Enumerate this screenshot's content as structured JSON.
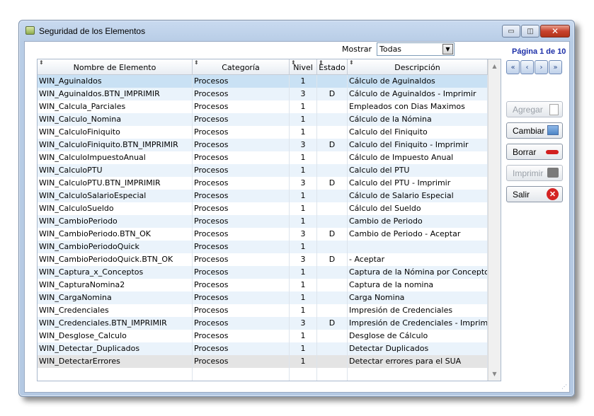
{
  "window": {
    "title": "Seguridad de los Elementos"
  },
  "filter": {
    "label": "Mostrar",
    "value": "Todas"
  },
  "pagination": {
    "text": "Página 1 de 10"
  },
  "actions": {
    "agregar": "Agregar",
    "cambiar": "Cambiar",
    "borrar": "Borrar",
    "imprimir": "Imprimir",
    "salir": "Salir"
  },
  "grid": {
    "headers": [
      "Nombre de Elemento",
      "Categoría",
      "Nivel",
      "Estado",
      "Descripción"
    ],
    "rows": [
      [
        "WIN_Aguinaldos",
        "Procesos",
        "1",
        "",
        "Cálculo de Aguinaldos"
      ],
      [
        "WIN_Aguinaldos.BTN_IMPRIMIR",
        "Procesos",
        "3",
        "D",
        "Cálculo de Aguinaldos - Imprimir"
      ],
      [
        "WIN_Calcula_Parciales",
        "Procesos",
        "1",
        "",
        "Empleados con Dias Maximos"
      ],
      [
        "WIN_Calculo_Nomina",
        "Procesos",
        "1",
        "",
        "Cálculo de la Nómina"
      ],
      [
        "WIN_CalculoFiniquito",
        "Procesos",
        "1",
        "",
        "Calculo del Finiquito"
      ],
      [
        "WIN_CalculoFiniquito.BTN_IMPRIMIR",
        "Procesos",
        "3",
        "D",
        "Calculo del Finiquito - Imprimir"
      ],
      [
        "WIN_CalculoImpuestoAnual",
        "Procesos",
        "1",
        "",
        "Cálculo de Impuesto Anual"
      ],
      [
        "WIN_CalculoPTU",
        "Procesos",
        "1",
        "",
        "Calculo del PTU"
      ],
      [
        "WIN_CalculoPTU.BTN_IMPRIMIR",
        "Procesos",
        "3",
        "D",
        "Calculo del PTU - Imprimir"
      ],
      [
        "WIN_CalculoSalarioEspecial",
        "Procesos",
        "1",
        "",
        "Cálculo de Salario Especial"
      ],
      [
        "WIN_CalculoSueldo",
        "Procesos",
        "1",
        "",
        "Cálculo del Sueldo"
      ],
      [
        "WIN_CambioPeriodo",
        "Procesos",
        "1",
        "",
        "Cambio de Periodo"
      ],
      [
        "WIN_CambioPeriodo.BTN_OK",
        "Procesos",
        "3",
        "D",
        "Cambio de Periodo - Aceptar"
      ],
      [
        "WIN_CambioPeriodoQuick",
        "Procesos",
        "1",
        "",
        ""
      ],
      [
        "WIN_CambioPeriodoQuick.BTN_OK",
        "Procesos",
        "3",
        "D",
        " - Aceptar"
      ],
      [
        "WIN_Captura_x_Conceptos",
        "Procesos",
        "1",
        "",
        "Captura de la Nómina por Conceptos"
      ],
      [
        "WIN_CapturaNomina2",
        "Procesos",
        "1",
        "",
        "Captura de la nomina"
      ],
      [
        "WIN_CargaNomina",
        "Procesos",
        "1",
        "",
        "Carga Nomina"
      ],
      [
        "WIN_Credenciales",
        "Procesos",
        "1",
        "",
        "Impresión de Credenciales"
      ],
      [
        "WIN_Credenciales.BTN_IMPRIMIR",
        "Procesos",
        "3",
        "D",
        "Impresión de Credenciales - Imprimir"
      ],
      [
        "WIN_Desglose_Calculo",
        "Procesos",
        "1",
        "",
        "Desglose de Cálculo"
      ],
      [
        "WIN_Detectar_Duplicados",
        "Procesos",
        "1",
        "",
        "Detectar Duplicados"
      ],
      [
        "WIN_DetectarErrores",
        "Procesos",
        "1",
        "",
        "Detectar errores para el SUA"
      ]
    ]
  }
}
